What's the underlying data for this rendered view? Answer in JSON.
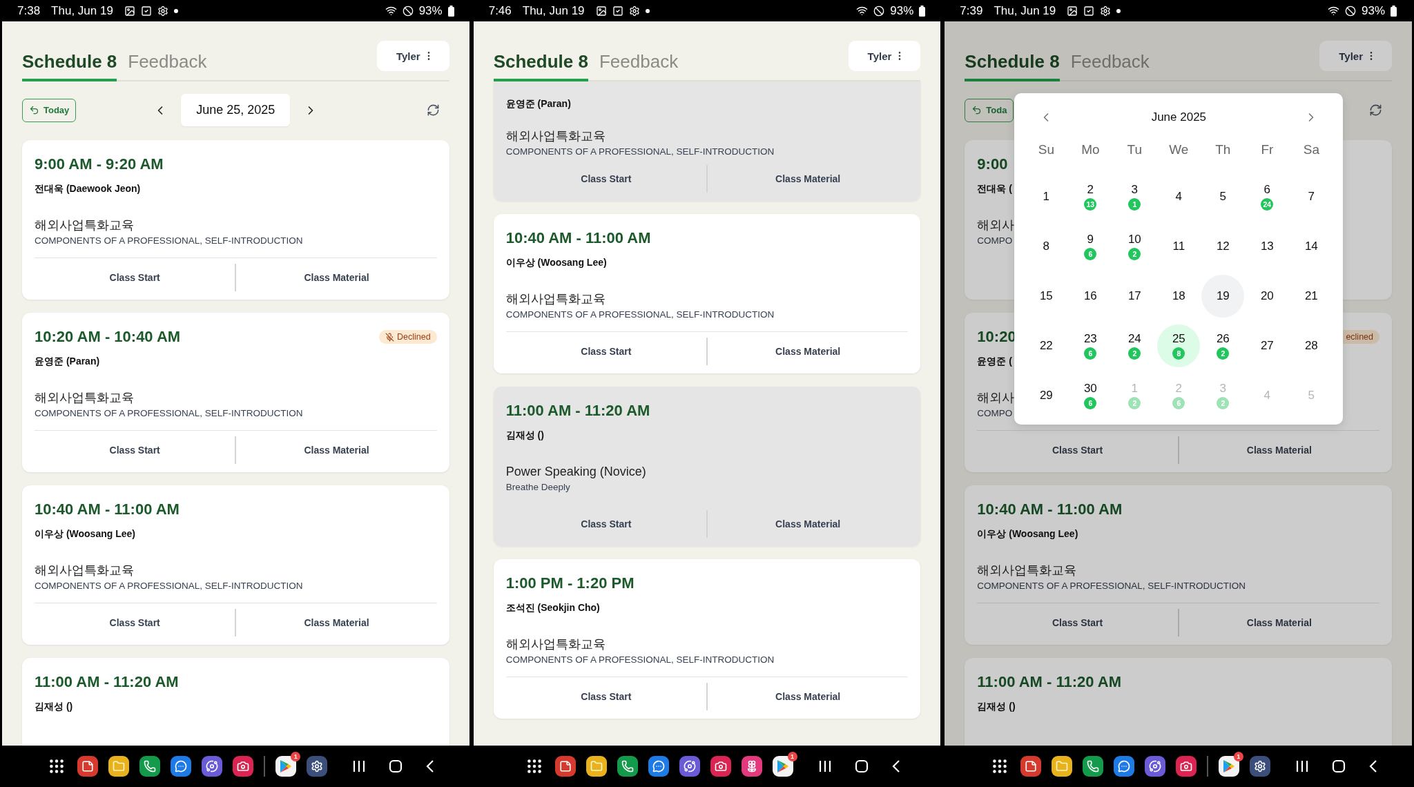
{
  "panels": [
    {
      "status_bar": {
        "time": "7:38",
        "date": "Thu, Jun 19",
        "battery": "93%"
      },
      "dimmed": false,
      "tabs": [
        {
          "label": "Schedule 8",
          "selected": true
        },
        {
          "label": "Feedback",
          "selected": false
        }
      ],
      "user_menu": "Tyler",
      "toolbar": {
        "today": "Today",
        "date": "June 25, 2025"
      },
      "cards": [
        {
          "time": "9:00 AM - 9:20 AM",
          "teacher": "전대욱 (Daewook Jeon)",
          "course": "해외사업특화교육",
          "topic": "COMPONENTS OF A PROFESSIONAL, SELF-INTRODUCTION",
          "actions": [
            "Class Start",
            "Class Material"
          ],
          "dimmed": false
        },
        {
          "time": "10:20 AM - 10:40 AM",
          "badge": "Declined",
          "badge_icon": true,
          "teacher": "윤영준 (Paran)",
          "course": "해외사업특화교육",
          "topic": "COMPONENTS OF A PROFESSIONAL, SELF-INTRODUCTION",
          "actions": [
            "Class Start",
            "Class Material"
          ],
          "dimmed": false
        },
        {
          "time": "10:40 AM - 11:00 AM",
          "teacher": "이우상 (Woosang Lee)",
          "course": "해외사업특화교육",
          "topic": "COMPONENTS OF A PROFESSIONAL, SELF-INTRODUCTION",
          "actions": [
            "Class Start",
            "Class Material"
          ],
          "dimmed": false
        },
        {
          "time": "11:00 AM - 11:20 AM",
          "teacher": "김재성 ()",
          "dimmed": false
        }
      ],
      "dock": [
        {
          "kind": "grid"
        },
        {
          "kind": "notes"
        },
        {
          "kind": "folder"
        },
        {
          "kind": "phone"
        },
        {
          "kind": "chat"
        },
        {
          "kind": "planet"
        },
        {
          "kind": "camera"
        },
        {
          "kind": "divider"
        },
        {
          "kind": "store",
          "badge": "1"
        },
        {
          "kind": "settings"
        }
      ]
    },
    {
      "status_bar": {
        "time": "7:46",
        "date": "Thu, Jun 19",
        "battery": "93%"
      },
      "dimmed": false,
      "tabs": [
        {
          "label": "Schedule 8",
          "selected": true
        },
        {
          "label": "Feedback",
          "selected": false
        }
      ],
      "user_menu": "Tyler",
      "cards": [
        {
          "teacher": "윤영준 (Paran)",
          "course": "해외사업특화교육",
          "topic": "COMPONENTS OF A PROFESSIONAL, SELF-INTRODUCTION",
          "actions": [
            "Class Start",
            "Class Material"
          ],
          "dimmed": true
        },
        {
          "time": "10:40 AM - 11:00 AM",
          "teacher": "이우상 (Woosang Lee)",
          "course": "해외사업특화교육",
          "topic": "COMPONENTS OF A PROFESSIONAL, SELF-INTRODUCTION",
          "actions": [
            "Class Start",
            "Class Material"
          ],
          "dimmed": false
        },
        {
          "time": "11:00 AM - 11:20 AM",
          "teacher": "김재성 ()",
          "course": "Power Speaking (Novice)",
          "topic": "Breathe Deeply",
          "actions": [
            "Class Start",
            "Class Material"
          ],
          "dimmed": true
        },
        {
          "time": "1:00 PM - 1:20 PM",
          "teacher": "조석진 (Seokjin Cho)",
          "course": "해외사업특화교육",
          "topic": "COMPONENTS OF A PROFESSIONAL, SELF-INTRODUCTION",
          "actions": [
            "Class Start",
            "Class Material"
          ],
          "dimmed": false
        }
      ],
      "dock": [
        {
          "kind": "grid"
        },
        {
          "kind": "notes"
        },
        {
          "kind": "folder"
        },
        {
          "kind": "phone"
        },
        {
          "kind": "chat"
        },
        {
          "kind": "planet"
        },
        {
          "kind": "camera"
        },
        {
          "kind": "flower"
        },
        {
          "kind": "store",
          "badge": "1"
        }
      ]
    },
    {
      "status_bar": {
        "time": "7:39",
        "date": "Thu, Jun 19",
        "battery": "93%"
      },
      "dimmed": true,
      "tabs": [
        {
          "label": "Schedule 8",
          "selected": true
        },
        {
          "label": "Feedback",
          "selected": false
        }
      ],
      "user_menu": "Tyler",
      "toolbar": {
        "today": "Toda"
      },
      "cards": [
        {
          "time": "9:00",
          "teacher": "전대욱 (",
          "course": "해외사",
          "topic": "COMPO",
          "dimmed": false
        },
        {
          "time": "10:20",
          "badge": "eclined",
          "badge_icon": false,
          "teacher": "윤영준 (",
          "course": "해외사",
          "topic": "COMPO",
          "actions": [
            "Class Start",
            "Class Material"
          ],
          "dimmed": false
        },
        {
          "time": "10:40 AM - 11:00 AM",
          "teacher": "이우상 (Woosang Lee)",
          "course": "해외사업특화교육",
          "topic": "COMPONENTS OF A PROFESSIONAL, SELF-INTRODUCTION",
          "actions": [
            "Class Start",
            "Class Material"
          ],
          "dimmed": false
        },
        {
          "time": "11:00 AM - 11:20 AM",
          "teacher": "김재성 ()",
          "dimmed": false
        }
      ],
      "calendar": {
        "title": "June 2025",
        "weekdays": [
          "Su",
          "Mo",
          "Tu",
          "We",
          "Th",
          "Fr",
          "Sa"
        ],
        "days": [
          {
            "day": "1",
            "selected": false,
            "today": false,
            "outside": false
          },
          {
            "day": "2",
            "count": "13",
            "selected": false,
            "today": false,
            "outside": false
          },
          {
            "day": "3",
            "count": "1",
            "selected": false,
            "today": false,
            "outside": false
          },
          {
            "day": "4",
            "selected": false,
            "today": false,
            "outside": false
          },
          {
            "day": "5",
            "selected": false,
            "today": false,
            "outside": false
          },
          {
            "day": "6",
            "count": "24",
            "selected": false,
            "today": false,
            "outside": false
          },
          {
            "day": "7",
            "selected": false,
            "today": false,
            "outside": false
          },
          {
            "day": "8",
            "selected": false,
            "today": false,
            "outside": false
          },
          {
            "day": "9",
            "count": "6",
            "selected": false,
            "today": false,
            "outside": false
          },
          {
            "day": "10",
            "count": "2",
            "selected": false,
            "today": false,
            "outside": false
          },
          {
            "day": "11",
            "selected": false,
            "today": false,
            "outside": false
          },
          {
            "day": "12",
            "selected": false,
            "today": false,
            "outside": false
          },
          {
            "day": "13",
            "selected": false,
            "today": false,
            "outside": false
          },
          {
            "day": "14",
            "selected": false,
            "today": false,
            "outside": false
          },
          {
            "day": "15",
            "selected": false,
            "today": false,
            "outside": false
          },
          {
            "day": "16",
            "selected": false,
            "today": false,
            "outside": false
          },
          {
            "day": "17",
            "selected": false,
            "today": false,
            "outside": false
          },
          {
            "day": "18",
            "selected": false,
            "today": false,
            "outside": false
          },
          {
            "day": "19",
            "selected": false,
            "today": true,
            "outside": false
          },
          {
            "day": "20",
            "selected": false,
            "today": false,
            "outside": false
          },
          {
            "day": "21",
            "selected": false,
            "today": false,
            "outside": false
          },
          {
            "day": "22",
            "selected": false,
            "today": false,
            "outside": false
          },
          {
            "day": "23",
            "count": "6",
            "selected": false,
            "today": false,
            "outside": false
          },
          {
            "day": "24",
            "count": "2",
            "selected": false,
            "today": false,
            "outside": false
          },
          {
            "day": "25",
            "count": "8",
            "selected": true,
            "today": false,
            "outside": false
          },
          {
            "day": "26",
            "count": "2",
            "selected": false,
            "today": false,
            "outside": false
          },
          {
            "day": "27",
            "selected": false,
            "today": false,
            "outside": false
          },
          {
            "day": "28",
            "selected": false,
            "today": false,
            "outside": false
          },
          {
            "day": "29",
            "selected": false,
            "today": false,
            "outside": false
          },
          {
            "day": "30",
            "count": "6",
            "selected": false,
            "today": false,
            "outside": false
          },
          {
            "day": "1",
            "count": "2",
            "selected": false,
            "today": false,
            "outside": true
          },
          {
            "day": "2",
            "count": "6",
            "selected": false,
            "today": false,
            "outside": true
          },
          {
            "day": "3",
            "count": "2",
            "selected": false,
            "today": false,
            "outside": true
          },
          {
            "day": "4",
            "selected": false,
            "today": false,
            "outside": true
          },
          {
            "day": "5",
            "selected": false,
            "today": false,
            "outside": true
          }
        ]
      },
      "dock": [
        {
          "kind": "grid"
        },
        {
          "kind": "notes"
        },
        {
          "kind": "folder"
        },
        {
          "kind": "phone"
        },
        {
          "kind": "chat"
        },
        {
          "kind": "planet"
        },
        {
          "kind": "camera"
        },
        {
          "kind": "divider"
        },
        {
          "kind": "store",
          "badge": "1"
        },
        {
          "kind": "settings"
        }
      ]
    }
  ]
}
